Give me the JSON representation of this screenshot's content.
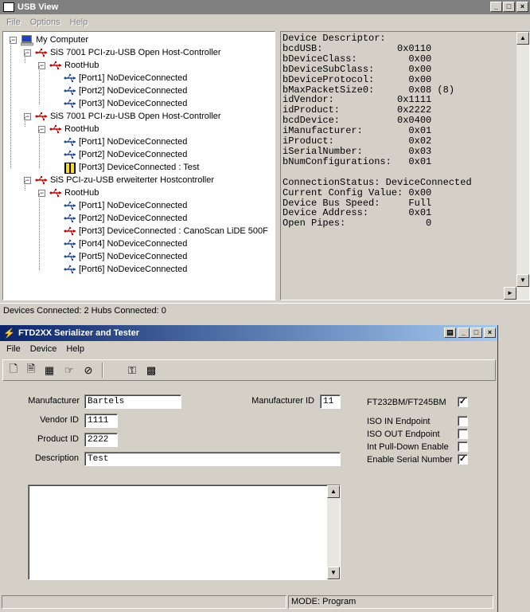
{
  "usbview": {
    "title": "USB View",
    "menu": [
      "File",
      "Options",
      "Help"
    ],
    "tree": {
      "root": "My Computer",
      "controllers": [
        {
          "label": "SiS 7001 PCI-zu-USB Open Host-Controller",
          "hub": "RootHub",
          "ports": [
            {
              "label": "[Port1] NoDeviceConnected",
              "connected": false
            },
            {
              "label": "[Port2] NoDeviceConnected",
              "connected": false
            },
            {
              "label": "[Port3] NoDeviceConnected",
              "connected": false
            }
          ]
        },
        {
          "label": "SiS 7001 PCI-zu-USB Open Host-Controller",
          "hub": "RootHub",
          "ports": [
            {
              "label": "[Port1] NoDeviceConnected",
              "connected": false
            },
            {
              "label": "[Port2] NoDeviceConnected",
              "connected": false
            },
            {
              "label": "[Port3] DeviceConnected : Test",
              "connected": true,
              "special": true
            }
          ]
        },
        {
          "label": "SiS PCI-zu-USB erweiterter Hostcontroller",
          "hub": "RootHub",
          "ports": [
            {
              "label": "[Port1] NoDeviceConnected",
              "connected": false
            },
            {
              "label": "[Port2] NoDeviceConnected",
              "connected": false
            },
            {
              "label": "[Port3] DeviceConnected : CanoScan LiDE 500F",
              "connected": true
            },
            {
              "label": "[Port4] NoDeviceConnected",
              "connected": false
            },
            {
              "label": "[Port5] NoDeviceConnected",
              "connected": false
            },
            {
              "label": "[Port6] NoDeviceConnected",
              "connected": false
            }
          ]
        }
      ]
    },
    "details_text": "Device Descriptor:\nbcdUSB:             0x0110\nbDeviceClass:         0x00\nbDeviceSubClass:      0x00\nbDeviceProtocol:      0x00\nbMaxPacketSize0:      0x08 (8)\nidVendor:           0x1111\nidProduct:          0x2222\nbcdDevice:          0x0400\niManufacturer:        0x01\niProduct:             0x02\niSerialNumber:        0x03\nbNumConfigurations:   0x01\n\nConnectionStatus: DeviceConnected\nCurrent Config Value: 0x00\nDevice Bus Speed:     Full\nDevice Address:       0x01\nOpen Pipes:              0",
    "status": "Devices Connected: 2   Hubs Connected: 0"
  },
  "ftd": {
    "title": "FTD2XX Serializer and Tester",
    "menu": [
      "File",
      "Device",
      "Help"
    ],
    "form": {
      "manufacturer_label": "Manufacturer",
      "manufacturer_value": "Bartels",
      "vendor_id_label": "Vendor ID",
      "vendor_id_value": "1111",
      "product_id_label": "Product ID",
      "product_id_value": "2222",
      "description_label": "Description",
      "description_value": "Test",
      "manufacturer_id_label": "Manufacturer ID",
      "manufacturer_id_value": "11"
    },
    "options": [
      {
        "label": "FT232BM/FT245BM",
        "checked": true
      },
      {
        "label": "ISO IN Endpoint",
        "checked": false
      },
      {
        "label": "ISO OUT Endpoint",
        "checked": false
      },
      {
        "label": "Int Pull-Down Enable",
        "checked": false
      },
      {
        "label": "Enable Serial Number",
        "checked": true
      }
    ],
    "status_mode": "MODE: Program"
  },
  "colors": {
    "usb_icon": "#c00000",
    "title_active": "#0a246a",
    "title_inactive": "#808080"
  }
}
